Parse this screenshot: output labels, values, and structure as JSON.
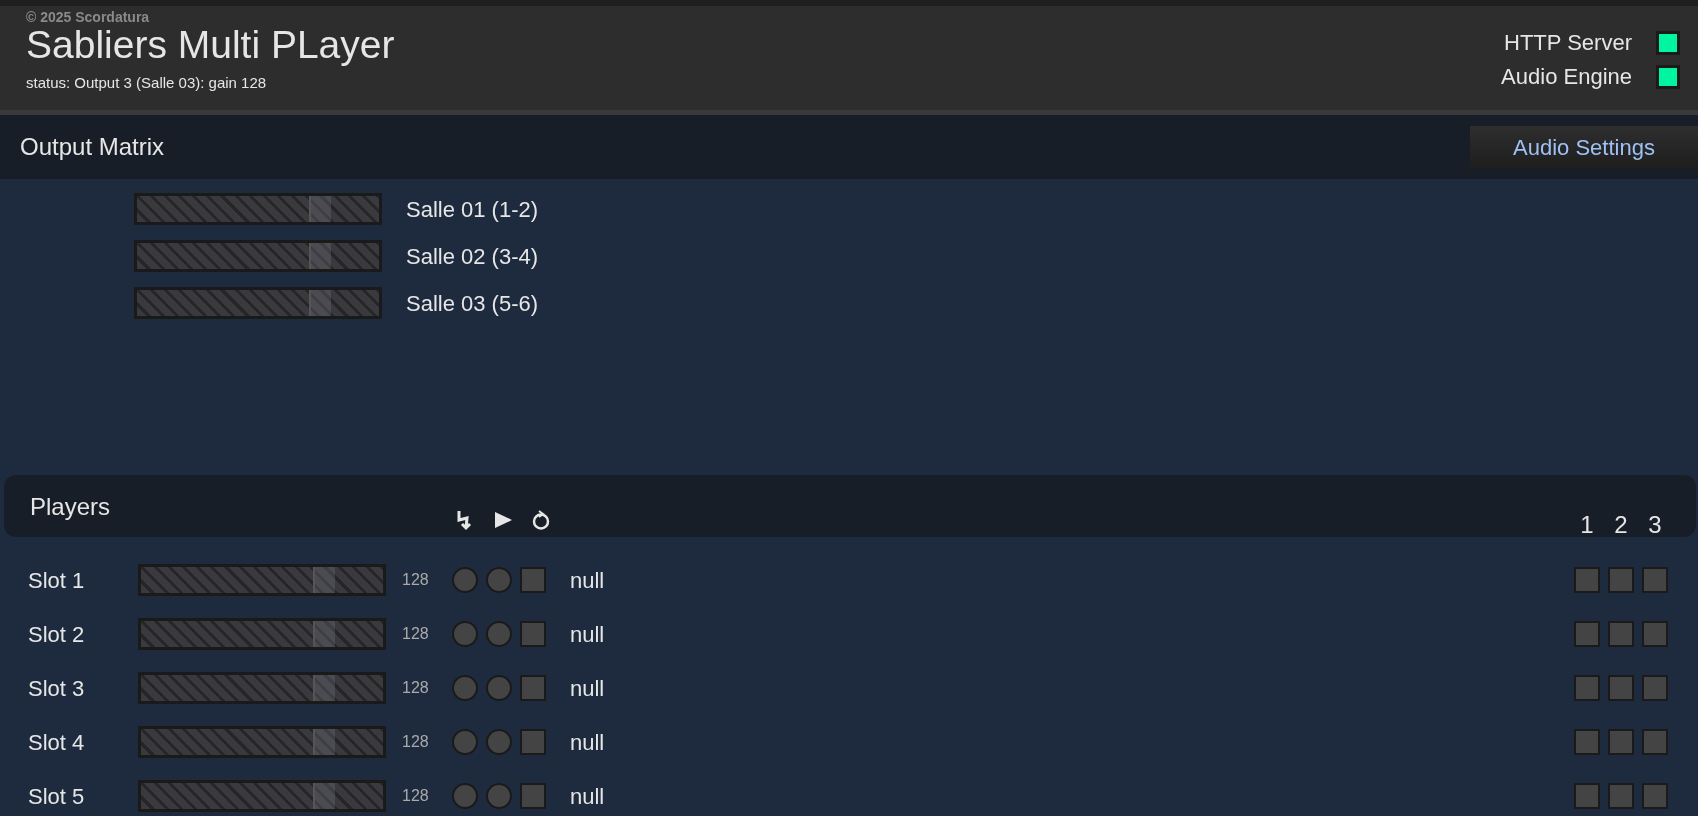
{
  "header": {
    "copyright": "© 2025 Scordatura",
    "title": "Sabliers Multi PLayer",
    "status": "status: Output 3 (Salle 03): gain 128",
    "indicators": [
      {
        "label": "HTTP Server",
        "on": true
      },
      {
        "label": "Audio Engine",
        "on": true
      }
    ]
  },
  "output_matrix": {
    "title": "Output Matrix",
    "button": "Audio Settings",
    "outputs": [
      {
        "name": "Salle 01 (1-2)",
        "level": 0.8
      },
      {
        "name": "Salle 02 (3-4)",
        "level": 0.8
      },
      {
        "name": "Salle 03 (5-6)",
        "level": 0.8
      }
    ]
  },
  "players": {
    "title": "Players",
    "output_columns": [
      "1",
      "2",
      "3"
    ],
    "slots": [
      {
        "name": "Slot 1",
        "level": 0.8,
        "gain": "128",
        "trigger_on": false,
        "play_on": false,
        "loop_checked": false,
        "file": "null",
        "routes": [
          false,
          false,
          false
        ]
      },
      {
        "name": "Slot 2",
        "level": 0.8,
        "gain": "128",
        "trigger_on": false,
        "play_on": false,
        "loop_checked": false,
        "file": "null",
        "routes": [
          false,
          false,
          false
        ]
      },
      {
        "name": "Slot 3",
        "level": 0.8,
        "gain": "128",
        "trigger_on": false,
        "play_on": false,
        "loop_checked": false,
        "file": "null",
        "routes": [
          false,
          false,
          false
        ]
      },
      {
        "name": "Slot 4",
        "level": 0.8,
        "gain": "128",
        "trigger_on": false,
        "play_on": false,
        "loop_checked": false,
        "file": "null",
        "routes": [
          false,
          false,
          false
        ]
      },
      {
        "name": "Slot 5",
        "level": 0.8,
        "gain": "128",
        "trigger_on": false,
        "play_on": false,
        "loop_checked": false,
        "file": "null",
        "routes": [
          false,
          false,
          false
        ]
      }
    ]
  }
}
